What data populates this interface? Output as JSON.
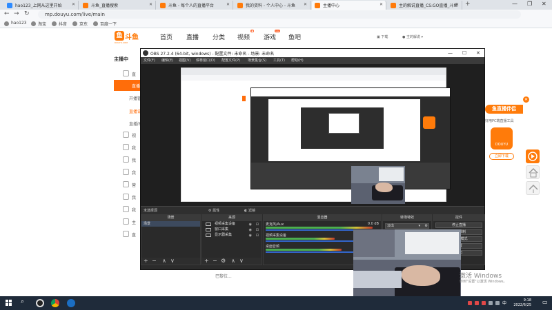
{
  "browser": {
    "tabs": [
      {
        "label": "hao123_上网从这里开始",
        "active": false
      },
      {
        "label": "斗鱼_直播搜索",
        "active": false
      },
      {
        "label": "斗鱼 - 每个人的直播平台",
        "active": false
      },
      {
        "label": "我的资料 - 个人中心 - 斗鱼",
        "active": false
      },
      {
        "label": "主播中心",
        "active": true
      },
      {
        "label": "主的解说直播_CS:GO直播_斗鱼",
        "active": false
      }
    ],
    "url": "mp.douyu.com/live/main",
    "bookmarks": [
      "hao123",
      "淘宝",
      "抖音",
      "京东",
      "百度一下"
    ]
  },
  "site": {
    "logo_text": "斗鱼",
    "logo_sub": "DOUYU.COM",
    "nav": [
      {
        "label": "首页",
        "badge": ""
      },
      {
        "label": "直播",
        "badge": ""
      },
      {
        "label": "分类",
        "badge": ""
      },
      {
        "label": "视频",
        "badge": "●"
      },
      {
        "label": "游戏",
        "badge": "new"
      },
      {
        "label": "鱼吧",
        "badge": ""
      }
    ],
    "header_right": {
      "download": "下载",
      "user": "主的解说"
    },
    "left_menu": {
      "title": "主播中",
      "items": [
        "直",
        "视",
        "我",
        "我",
        "我",
        "营",
        "我",
        "我",
        "主",
        "直"
      ],
      "active_item": "直播",
      "subs": [
        "开播管",
        "直播设",
        "直播间"
      ]
    },
    "promo": {
      "title": "鱼直播伴侣",
      "desc": "好用PC端直播工具",
      "app_label": "DOUYU",
      "button": "立即下载"
    },
    "footer_note": "巴黎位..."
  },
  "obs": {
    "title": "OBS 27.2.4 (64-bit, windows) - 配置文件: 未命名 - 场景: 未命名",
    "menu": [
      "文件(F)",
      "编辑(E)",
      "视图(V)",
      "停靠窗口(D)",
      "配置文件(P)",
      "场景集合(S)",
      "工具(T)",
      "帮助(H)"
    ],
    "status_row": {
      "left": "未选择源",
      "props": "属性",
      "filters": "滤镜"
    },
    "scenes": {
      "header": "场景",
      "items": [
        "场景"
      ]
    },
    "sources": {
      "header": "来源",
      "items": [
        "视频采集设备",
        "窗口采集",
        "显示器采集"
      ]
    },
    "mixer": {
      "header": "混音器",
      "channels": [
        {
          "name": "麦克风/Aux",
          "db": "0.0 dB",
          "level": 0.85
        },
        {
          "name": "视频采集设备",
          "db": "",
          "level": 0.55
        },
        {
          "name": "桌面音频",
          "db": "",
          "level": 0.6
        }
      ]
    },
    "transitions": {
      "header": "转场特效",
      "value": "淡出"
    },
    "controls": {
      "header": "控件",
      "buttons": [
        "停止直播",
        "开始录制",
        "工作室模式",
        "设置",
        "退出"
      ]
    }
  },
  "watermark": {
    "title": "激活 Windows",
    "sub": "转到\"设置\"以激活 Windows。"
  },
  "taskbar": {
    "time": "9:18",
    "date": "2022/6/25"
  }
}
